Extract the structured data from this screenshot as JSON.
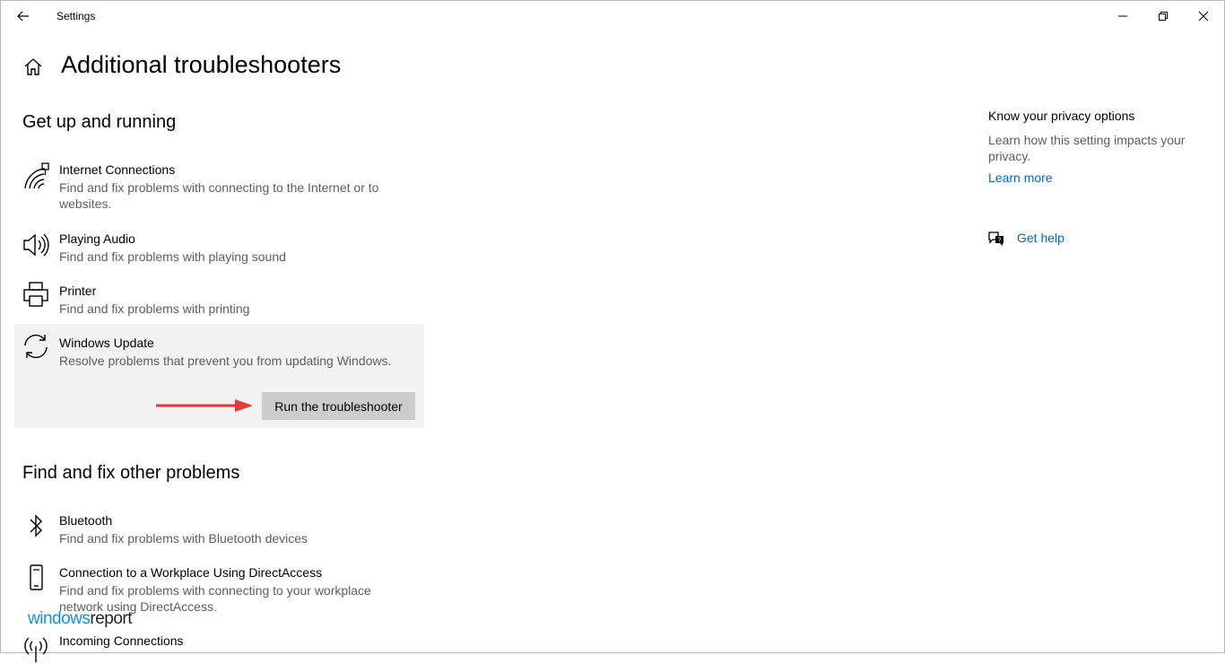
{
  "window": {
    "title": "Settings",
    "controls": {
      "back": "back-arrow-icon",
      "minimize": "minimize-icon",
      "maximize": "restore-icon",
      "close": "close-icon"
    }
  },
  "page": {
    "title": "Additional troubleshooters"
  },
  "sections": {
    "running": {
      "heading": "Get up and running",
      "items": [
        {
          "name": "Internet Connections",
          "desc": "Find and fix problems with connecting to the Internet or to websites.",
          "icon": "network-icon"
        },
        {
          "name": "Playing Audio",
          "desc": "Find and fix problems with playing sound",
          "icon": "speaker-icon"
        },
        {
          "name": "Printer",
          "desc": "Find and fix problems with printing",
          "icon": "printer-icon"
        },
        {
          "name": "Windows Update",
          "desc": "Resolve problems that prevent you from updating Windows.",
          "icon": "sync-icon",
          "button": "Run the troubleshooter"
        }
      ]
    },
    "other": {
      "heading": "Find and fix other problems",
      "items": [
        {
          "name": "Bluetooth",
          "desc": "Find and fix problems with Bluetooth devices",
          "icon": "bluetooth-icon"
        },
        {
          "name": "Connection to a Workplace Using DirectAccess",
          "desc": "Find and fix problems with connecting to your workplace network using DirectAccess.",
          "icon": "phone-icon"
        },
        {
          "name": "Incoming Connections",
          "icon": "antenna-icon"
        }
      ]
    }
  },
  "sidebar": {
    "privacy_title": "Know your privacy options",
    "privacy_desc": "Learn how this setting impacts your privacy.",
    "learn_more": "Learn more",
    "get_help": "Get help"
  },
  "watermark": {
    "part1": "windows",
    "part2": "report"
  },
  "colors": {
    "accent": "#0067b8",
    "selected_bg": "#f2f2f2",
    "button_bg": "#cccccc",
    "arrow": "#e03c3c"
  }
}
